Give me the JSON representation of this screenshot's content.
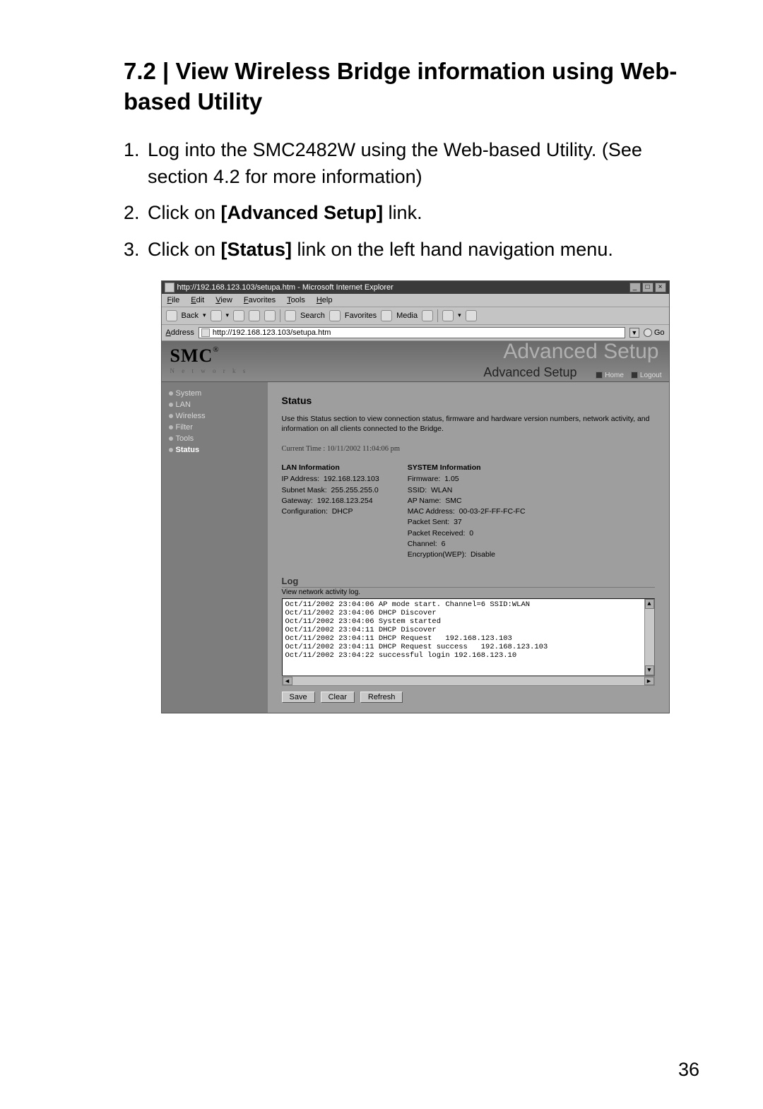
{
  "doc": {
    "heading": "7.2 | View Wireless Bridge information using Web-based Utility",
    "steps": [
      {
        "n": "1.",
        "pre": "Log into the SMC2482W using the Web-based Utility. (See section 4.2 for more information)",
        "bold": "",
        "post": ""
      },
      {
        "n": "2.",
        "pre": "Click on ",
        "bold": "[Advanced Setup]",
        "post": " link."
      },
      {
        "n": "3.",
        "pre": "Click on ",
        "bold": "[Status]",
        "post": " link on the left hand navigation menu."
      }
    ],
    "page_num": "36"
  },
  "ie": {
    "title": "http://192.168.123.103/setupa.htm - Microsoft Internet Explorer",
    "menus": [
      "File",
      "Edit",
      "View",
      "Favorites",
      "Tools",
      "Help"
    ],
    "toolbar": {
      "back": "Back",
      "search": "Search",
      "fav": "Favorites",
      "media": "Media"
    },
    "address_label": "Address",
    "address_value": "http://192.168.123.103/setupa.htm",
    "go": "Go"
  },
  "app": {
    "brand": "SMC",
    "brand_reg": "®",
    "brand_sub": "N e t w o r k s",
    "ghost": "Advanced Setup",
    "subtitle": "Advanced Setup",
    "home": "Home",
    "logout": "Logout",
    "sidebar": [
      {
        "label": "System"
      },
      {
        "label": "LAN"
      },
      {
        "label": "Wireless"
      },
      {
        "label": "Filter"
      },
      {
        "label": "Tools"
      },
      {
        "label": "Status"
      }
    ],
    "status": {
      "title": "Status",
      "desc": "Use this Status section to view connection status, firmware and hardware version numbers, network activity, and information on all clients connected to the Bridge.",
      "current_time_label": "Current Time :",
      "current_time": "10/11/2002 11:04:06 pm",
      "lan_title": "LAN Information",
      "lan": {
        "ip_label": "IP Address:",
        "ip": "192.168.123.103",
        "mask_label": "Subnet Mask:",
        "mask": "255.255.255.0",
        "gw_label": "Gateway:",
        "gw": "192.168.123.254",
        "cfg_label": "Configuration:",
        "cfg": "DHCP"
      },
      "sys_title": "SYSTEM Information",
      "sys": {
        "fw_label": "Firmware:",
        "fw": "1.05",
        "ssid_label": "SSID:",
        "ssid": "WLAN",
        "ap_label": "AP Name:",
        "ap": "SMC",
        "mac_label": "MAC Address:",
        "mac": "00-03-2F-FF-FC-FC",
        "ps_label": "Packet Sent:",
        "ps": "37",
        "pr_label": "Packet Received:",
        "pr": "0",
        "ch_label": "Channel:",
        "ch": "6",
        "enc_label": "Encryption(WEP):",
        "enc": "Disable"
      },
      "log_title": "Log",
      "log_desc": "View network activity log.",
      "log_lines": [
        "Oct/11/2002 23:04:06 AP mode start. Channel=6 SSID:WLAN",
        "Oct/11/2002 23:04:06 DHCP Discover",
        "Oct/11/2002 23:04:06 System started",
        "Oct/11/2002 23:04:11 DHCP Discover",
        "Oct/11/2002 23:04:11 DHCP Request   192.168.123.103",
        "Oct/11/2002 23:04:11 DHCP Request success   192.168.123.103",
        "Oct/11/2002 23:04:22 successful login 192.168.123.10"
      ],
      "buttons": {
        "save": "Save",
        "clear": "Clear",
        "refresh": "Refresh"
      }
    }
  }
}
